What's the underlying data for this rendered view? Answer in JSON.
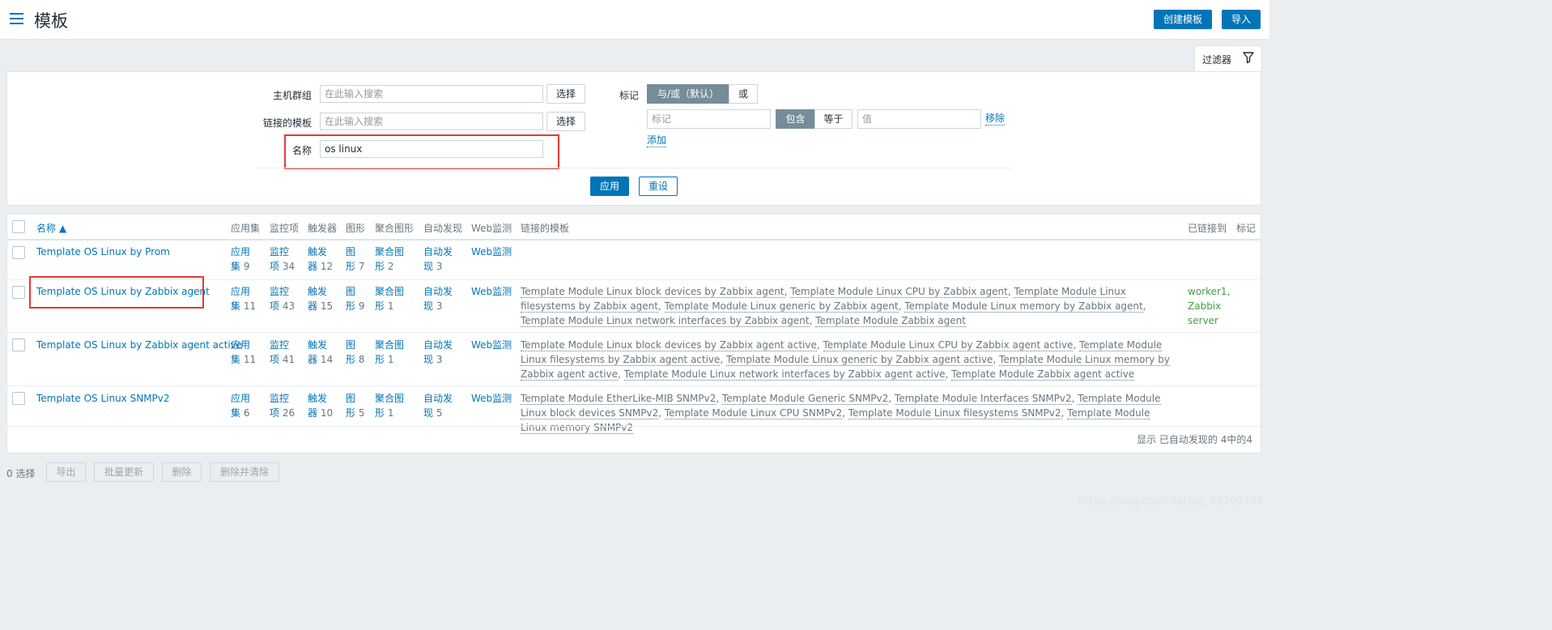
{
  "header": {
    "title": "模板",
    "create_btn": "创建模板",
    "import_btn": "导入"
  },
  "filter": {
    "tab_label": "过滤器",
    "host_group_label": "主机群组",
    "host_group_placeholder": "在此输入搜索",
    "linked_tpl_label": "链接的模板",
    "linked_tpl_placeholder": "在此输入搜索",
    "select_btn": "选择",
    "name_label": "名称",
    "name_value": "os linux",
    "tags_label": "标记",
    "and_or": "与/或（默认）",
    "or": "或",
    "tag_placeholder": "标记",
    "contains": "包含",
    "equals": "等于",
    "value_placeholder": "值",
    "remove": "移除",
    "add": "添加",
    "apply": "应用",
    "reset": "重设"
  },
  "table": {
    "headers": {
      "name": "名称 ▲",
      "apps": "应用集",
      "items": "监控项",
      "triggers": "触发器",
      "graphs": "图形",
      "screens": "聚合图形",
      "discovery": "自动发现",
      "web": "Web监测",
      "linked": "链接的模板",
      "linked_to": "已链接到",
      "tags": "标记"
    },
    "rows": [
      {
        "name": "Template OS Linux by Prom",
        "apps": [
          "应用",
          "集",
          "9"
        ],
        "items": [
          "监控",
          "项",
          "34"
        ],
        "triggers": [
          "触发",
          "器",
          "12"
        ],
        "graphs": [
          "图",
          "形",
          "7"
        ],
        "screens": [
          "聚合图",
          "形",
          "2"
        ],
        "discovery": [
          "自动发",
          "现",
          "3"
        ],
        "web": "Web监测",
        "linked": [],
        "linked_to": []
      },
      {
        "name": "Template OS Linux by Zabbix agent",
        "apps": [
          "应用",
          "集",
          "11"
        ],
        "items": [
          "监控",
          "项",
          "43"
        ],
        "triggers": [
          "触发",
          "器",
          "15"
        ],
        "graphs": [
          "图",
          "形",
          "9"
        ],
        "screens": [
          "聚合图",
          "形",
          "1"
        ],
        "discovery": [
          "自动发",
          "现",
          "3"
        ],
        "web": "Web监测",
        "linked": [
          "Template Module Linux block devices by Zabbix agent",
          "Template Module Linux CPU by Zabbix agent",
          "Template Module Linux filesystems by Zabbix agent",
          "Template Module Linux generic by Zabbix agent",
          "Template Module Linux memory by Zabbix agent",
          "Template Module Linux network interfaces by Zabbix agent",
          "Template Module Zabbix agent"
        ],
        "linked_to": [
          "worker1,",
          "Zabbix",
          "server"
        ]
      },
      {
        "name": "Template OS Linux by Zabbix agent active",
        "apps": [
          "应用",
          "集",
          "11"
        ],
        "items": [
          "监控",
          "项",
          "41"
        ],
        "triggers": [
          "触发",
          "器",
          "14"
        ],
        "graphs": [
          "图",
          "形",
          "8"
        ],
        "screens": [
          "聚合图",
          "形",
          "1"
        ],
        "discovery": [
          "自动发",
          "现",
          "3"
        ],
        "web": "Web监测",
        "linked": [
          "Template Module Linux block devices by Zabbix agent active",
          "Template Module Linux CPU by Zabbix agent active",
          "Template Module Linux filesystems by Zabbix agent active",
          "Template Module Linux generic by Zabbix agent active",
          "Template Module Linux memory by Zabbix agent active",
          "Template Module Linux network interfaces by Zabbix agent active",
          "Template Module Zabbix agent active"
        ],
        "linked_to": []
      },
      {
        "name": "Template OS Linux SNMPv2",
        "apps": [
          "应用",
          "集",
          "6"
        ],
        "items": [
          "监控",
          "项",
          "26"
        ],
        "triggers": [
          "触发",
          "器",
          "10"
        ],
        "graphs": [
          "图",
          "形",
          "5"
        ],
        "screens": [
          "聚合图",
          "形",
          "1"
        ],
        "discovery": [
          "自动发",
          "现",
          "5"
        ],
        "web": "Web监测",
        "linked": [
          "Template Module EtherLike-MIB SNMPv2",
          "Template Module Generic SNMPv2",
          "Template Module Interfaces SNMPv2",
          "Template Module Linux block devices SNMPv2",
          "Template Module Linux CPU SNMPv2",
          "Template Module Linux filesystems SNMPv2",
          "Template Module Linux memory SNMPv2"
        ],
        "linked_to": []
      }
    ],
    "footer": "显示 已自动发现的 4中的4"
  },
  "actions": {
    "selected": "0 选择",
    "export": "导出",
    "mass_update": "批量更新",
    "delete": "删除",
    "delete_clear": "删除并清除"
  },
  "watermark": "https://blog.csdn.net/qq_41709494"
}
